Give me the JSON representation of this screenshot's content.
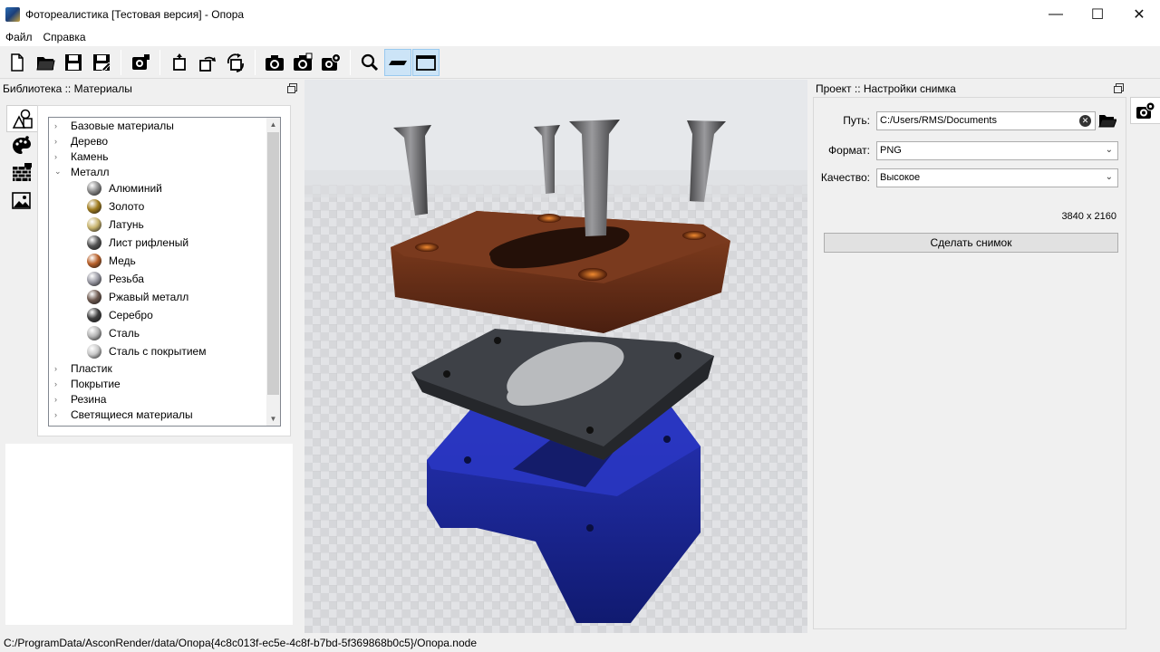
{
  "window": {
    "title": "Фотореалистика [Тестовая версия] - Опора",
    "minimize": "—",
    "maximize": "☐",
    "close": "✕"
  },
  "menu": [
    {
      "label": "Файл"
    },
    {
      "label": "Справка"
    }
  ],
  "toolbar": {
    "icons": [
      "new-file-icon",
      "open-folder-icon",
      "save-icon",
      "save-as-icon",
      "snapshot-settings-icon",
      "move-icon",
      "rotate-icon",
      "rotate-camera-icon",
      "camera-icon",
      "camera-batch-icon",
      "camera-settings-icon",
      "zoom-icon",
      "floor-icon",
      "frame-icon"
    ]
  },
  "left_panel": {
    "title": "Библиотека :: Материалы",
    "tree": [
      {
        "label": "Базовые материалы",
        "arrow": "›"
      },
      {
        "label": "Дерево",
        "arrow": "›"
      },
      {
        "label": "Камень",
        "arrow": "›"
      },
      {
        "label": "Металл",
        "arrow": "⌄",
        "children": [
          {
            "label": "Алюминий",
            "color": "#8a8a8a"
          },
          {
            "label": "Золото",
            "color": "#a07c1e"
          },
          {
            "label": "Латунь",
            "color": "#c8b46e"
          },
          {
            "label": "Лист рифленый",
            "color": "#555555"
          },
          {
            "label": "Медь",
            "color": "#b8602a"
          },
          {
            "label": "Резьба",
            "color": "#9a9aa4"
          },
          {
            "label": "Ржавый металл",
            "color": "#6e5a50"
          },
          {
            "label": "Серебро",
            "color": "#404040"
          },
          {
            "label": "Сталь",
            "color": "#b4b4b4"
          },
          {
            "label": "Сталь с покрытием",
            "color": "#c8c8c8"
          }
        ]
      },
      {
        "label": "Пластик",
        "arrow": "›"
      },
      {
        "label": "Покрытие",
        "arrow": "›"
      },
      {
        "label": "Резина",
        "arrow": "›"
      },
      {
        "label": "Светящиеся материалы",
        "arrow": "›"
      }
    ]
  },
  "right_panel": {
    "title": "Проект :: Настройки снимка",
    "path_label": "Путь:",
    "path_value": "C:/Users/RMS/Documents",
    "format_label": "Формат:",
    "format_value": "PNG",
    "quality_label": "Качество:",
    "quality_value": "Высокое",
    "resolution": "3840 x 2160",
    "snapshot_button": "Сделать снимок"
  },
  "status": {
    "path": "C:/ProgramData/AsconRender/data/Опора{4c8c013f-ec5e-4c8f-b7bd-5f369868b0c5}/Опора.node"
  },
  "colors": {
    "copper_plate": "#7a3a1e",
    "rubber_gasket": "#3a3d42",
    "blue_base": "#1e2a9c"
  }
}
